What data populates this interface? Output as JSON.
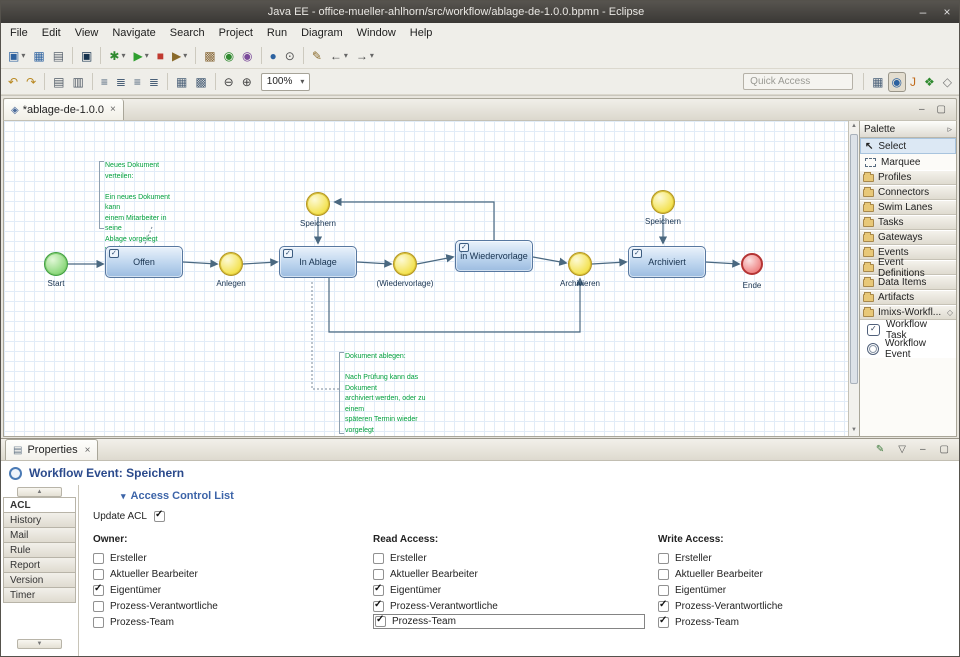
{
  "window": {
    "title": "Java EE - office-mueller-ahlhorn/src/workflow/ablage-de-1.0.0.bpmn - Eclipse",
    "minimize": "–",
    "close": "×"
  },
  "menubar": [
    "File",
    "Edit",
    "View",
    "Navigate",
    "Search",
    "Project",
    "Run",
    "Diagram",
    "Window",
    "Help"
  ],
  "toolbar1": {
    "g1": [
      {
        "n": "new-button",
        "g": "▣",
        "c": "#2d62a0",
        "dd": true
      },
      {
        "n": "save-button",
        "g": "▦",
        "c": "#2d62a0"
      },
      {
        "n": "print-button",
        "g": "▤",
        "c": "#5a6470"
      }
    ],
    "g2": [
      {
        "n": "console-button",
        "g": "▣",
        "c": "#17344f"
      }
    ],
    "g3": [
      {
        "n": "debug-button",
        "g": "✱",
        "c": "#2f8a2f",
        "dd": true
      },
      {
        "n": "run-button",
        "g": "▶",
        "c": "#2fa02f",
        "dd": true
      },
      {
        "n": "stop-button",
        "g": "■",
        "c": "#c03a30"
      },
      {
        "n": "coverage-button",
        "g": "▶",
        "c": "#8a6a2a",
        "dd": true
      }
    ],
    "g4": [
      {
        "n": "new-package-button",
        "g": "▩",
        "c": "#8a6a3a"
      },
      {
        "n": "new-class-button",
        "g": "◉",
        "c": "#2f8a2f"
      },
      {
        "n": "new-interface-button",
        "g": "◉",
        "c": "#7a4a9a"
      }
    ],
    "g5": [
      {
        "n": "open-web-browser-button",
        "g": "●",
        "c": "#2d62a0"
      },
      {
        "n": "search-button",
        "g": "⊙",
        "c": "#555555"
      }
    ],
    "g6": [
      {
        "n": "last-edit-location-button",
        "g": "✎",
        "c": "#8a6a2a"
      },
      {
        "n": "back-button",
        "g": "←",
        "c": "#444444",
        "dd": true
      },
      {
        "n": "forward-button",
        "g": "→",
        "c": "#444444",
        "dd": true
      }
    ]
  },
  "toolbar2": {
    "g1": [
      {
        "n": "undo-button",
        "g": "↶",
        "c": "#b8871f"
      },
      {
        "n": "redo-button",
        "g": "↷",
        "c": "#b8871f"
      }
    ],
    "g2": [
      {
        "n": "copy-button",
        "g": "▤",
        "c": "#505a66"
      },
      {
        "n": "paste-button",
        "g": "▥",
        "c": "#505a66"
      }
    ],
    "g3": [
      {
        "n": "align-horizontal-button",
        "g": "≡",
        "c": "#4a6078"
      },
      {
        "n": "align-vertical-button",
        "g": "≣",
        "c": "#4a6078"
      },
      {
        "n": "distribute-horizontal-button",
        "g": "≡",
        "c": "#4a6078"
      },
      {
        "n": "distribute-vertical-button",
        "g": "≣",
        "c": "#4a6078"
      }
    ],
    "g4": [
      {
        "n": "grid-button",
        "g": "▦",
        "c": "#4a6078"
      },
      {
        "n": "layers-button",
        "g": "▩",
        "c": "#4a6078"
      }
    ],
    "g5": [
      {
        "n": "zoom-out-button",
        "g": "⊖",
        "c": "#444444"
      },
      {
        "n": "zoom-in-button",
        "g": "⊕",
        "c": "#444444"
      }
    ],
    "zoom": "100%",
    "quick_access": "Quick Access",
    "perspectives": [
      {
        "n": "open-perspective-button",
        "g": "▦",
        "c": "#4a6078"
      },
      {
        "n": "javaee-perspective-button",
        "g": "◉",
        "c": "#2d62a0",
        "active": true
      },
      {
        "n": "java-perspective-button",
        "g": "J",
        "c": "#c06a1a"
      },
      {
        "n": "debug-perspective-button",
        "g": "❖",
        "c": "#2f8a2f"
      },
      {
        "n": "web-perspective-button",
        "g": "◇",
        "c": "#777777"
      }
    ]
  },
  "editor": {
    "tab_label": "*ablage-de-1.0.0",
    "tab_close": "×"
  },
  "diagram": {
    "nodes": {
      "start": "Start",
      "offen": "Offen",
      "anlegen": "Anlegen",
      "in_ablage": "In Ablage",
      "speichern1": "Speichern",
      "wiedervorlage": "(Wiedervorlage)",
      "in_wiedervorlage": "in Wiedervorlage",
      "archivieren": "Archivieren",
      "archiviert": "Archiviert",
      "speichern2": "Speichern",
      "ende": "Ende"
    },
    "annotations": {
      "a1": "Neues Dokument verteilen:\n\nEin neues Dokument kann\neinem Mitarbeiter in seine\nAblage vorgelegt werden",
      "a2": "Dokument ablegen:\n\nNach Prüfung kann das Dokument\narchiviert werden, oder zu einem\nspäteren Termin wieder vorgelegt\nwerden."
    }
  },
  "palette": {
    "title": "Palette",
    "tools": [
      {
        "label": "Select"
      },
      {
        "label": "Marquee"
      }
    ],
    "categories": [
      "Profiles",
      "Connectors",
      "Swim Lanes",
      "Tasks",
      "Gateways",
      "Events",
      "Event Definitions",
      "Data Items",
      "Artifacts"
    ],
    "drawer": "Imixs-Workfl...",
    "items": [
      "Workflow Task",
      "Workflow Event"
    ]
  },
  "properties": {
    "tab_label": "Properties",
    "tab_close": "×",
    "view_buttons": [
      {
        "n": "edit-mode-button",
        "g": "✎",
        "c": "#3a7a3a"
      },
      {
        "n": "view-menu-button",
        "g": "▽",
        "c": "#555555"
      },
      {
        "n": "minimize-view-button",
        "g": "–",
        "c": "#555555"
      },
      {
        "n": "maximize-view-button",
        "g": "▢",
        "c": "#555555"
      }
    ],
    "title": "Workflow Event: Speichern",
    "section": "Access Control List",
    "side_tabs": [
      {
        "n": "side-tab-acl",
        "label": "ACL",
        "active": true
      },
      {
        "n": "side-tab-history",
        "label": "History"
      },
      {
        "n": "side-tab-mail",
        "label": "Mail"
      },
      {
        "n": "side-tab-rule",
        "label": "Rule"
      },
      {
        "n": "side-tab-report",
        "label": "Report"
      },
      {
        "n": "side-tab-version",
        "label": "Version"
      },
      {
        "n": "side-tab-timer",
        "label": "Timer"
      }
    ],
    "update_label": "Update ACL",
    "update_checked": true,
    "columns": [
      {
        "header": "Owner:",
        "items": [
          {
            "label": "Ersteller"
          },
          {
            "label": "Aktueller Bearbeiter"
          },
          {
            "label": "Eigentümer",
            "checked": true
          },
          {
            "label": "Prozess-Verantwortliche"
          },
          {
            "label": "Prozess-Team"
          }
        ]
      },
      {
        "header": "Read Access:",
        "items": [
          {
            "label": "Ersteller"
          },
          {
            "label": "Aktueller Bearbeiter"
          },
          {
            "label": "Eigentümer",
            "checked": true
          },
          {
            "label": "Prozess-Verantwortliche",
            "checked": true
          },
          {
            "label": "Prozess-Team",
            "checked": true,
            "boxed": true
          }
        ]
      },
      {
        "header": "Write Access:",
        "items": [
          {
            "label": "Ersteller"
          },
          {
            "label": "Aktueller Bearbeiter"
          },
          {
            "label": "Eigentümer"
          },
          {
            "label": "Prozess-Verantwortliche",
            "checked": true
          },
          {
            "label": "Prozess-Team",
            "checked": true
          }
        ]
      }
    ]
  }
}
